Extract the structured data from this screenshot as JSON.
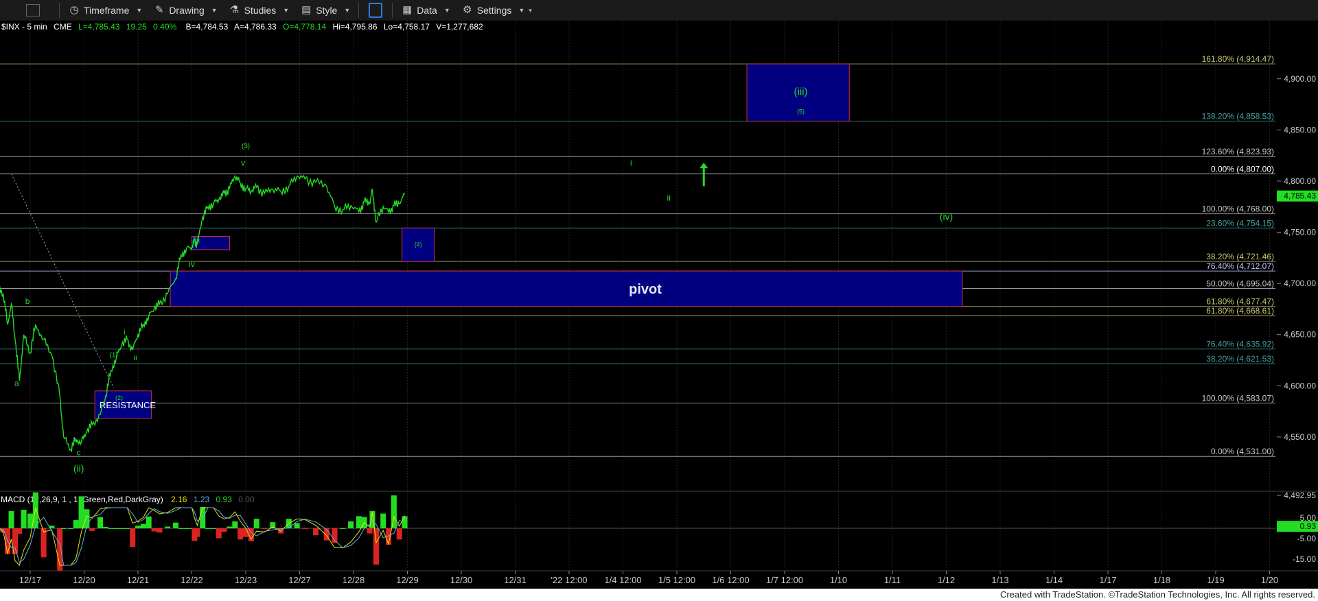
{
  "toolbar": {
    "timeframe": "Timeframe",
    "drawing": "Drawing",
    "studies": "Studies",
    "style": "Style",
    "data": "Data",
    "settings": "Settings",
    "icons": [
      "timeframe-icon",
      "drawing-icon",
      "studies-icon",
      "style-icon",
      "layout-icon",
      "data-icon",
      "settings-icon"
    ]
  },
  "header": {
    "symbol": "$INX - 5 min",
    "exchange": "CME",
    "last": "L=4,785.43",
    "change": "19.25",
    "pct": "0.40%",
    "bid": "B=4,784.53",
    "ask": "A=4,786.33",
    "open": "O=4,778.14",
    "high": "Hi=4,795.86",
    "low": "Lo=4,758.17",
    "volume": "V=1,277,682"
  },
  "footer": "Created with TradeStation. ©TradeStation Technologies, Inc. All rights reserved.",
  "chart_data": {
    "type": "line",
    "title": "$INX - 5 min",
    "color": "#22dd22",
    "ylim": [
      4492.95,
      4930
    ],
    "y_ticks": [
      {
        "v": 4900,
        "t": "4,900.00"
      },
      {
        "v": 4850,
        "t": "4,850.00"
      },
      {
        "v": 4800,
        "t": "4,800.00"
      },
      {
        "v": 4750,
        "t": "4,750.00"
      },
      {
        "v": 4700,
        "t": "4,700.00"
      },
      {
        "v": 4650,
        "t": "4,650.00"
      },
      {
        "v": 4600,
        "t": "4,600.00"
      },
      {
        "v": 4550,
        "t": "4,550.00"
      },
      {
        "v": 4492.95,
        "t": "4,492.95"
      }
    ],
    "last_price": {
      "v": 4785.43,
      "t": "4,785.43"
    },
    "x_labels": [
      {
        "i": 0,
        "t": "12/17"
      },
      {
        "i": 1,
        "t": "12/20"
      },
      {
        "i": 2,
        "t": "12/21"
      },
      {
        "i": 3,
        "t": "12/22"
      },
      {
        "i": 4,
        "t": "12/23"
      },
      {
        "i": 5,
        "t": "12/27"
      },
      {
        "i": 6,
        "t": "12/28"
      },
      {
        "i": 7,
        "t": "12/29"
      },
      {
        "i": 8,
        "t": "12/30"
      },
      {
        "i": 9,
        "t": "12/31"
      },
      {
        "i": 10,
        "t": "'22 12:00"
      },
      {
        "i": 11,
        "t": "1/4 12:00"
      },
      {
        "i": 12,
        "t": "1/5 12:00"
      },
      {
        "i": 13,
        "t": "1/6 12:00"
      },
      {
        "i": 14,
        "t": "1/7 12:00"
      },
      {
        "i": 15,
        "t": "1/10"
      },
      {
        "i": 16,
        "t": "1/11"
      },
      {
        "i": 17,
        "t": "1/12"
      },
      {
        "i": 18,
        "t": "1/13"
      },
      {
        "i": 19,
        "t": "1/14"
      },
      {
        "i": 20,
        "t": "1/17"
      },
      {
        "i": 21,
        "t": "1/18"
      },
      {
        "i": 22,
        "t": "1/19"
      },
      {
        "i": 23,
        "t": "1/20"
      }
    ],
    "price_path": [
      [
        -0.6,
        4695
      ],
      [
        -0.5,
        4690
      ],
      [
        -0.42,
        4660
      ],
      [
        -0.35,
        4680
      ],
      [
        -0.28,
        4645
      ],
      [
        -0.2,
        4605
      ],
      [
        -0.12,
        4650
      ],
      [
        0.0,
        4632
      ],
      [
        0.1,
        4660
      ],
      [
        0.25,
        4645
      ],
      [
        0.4,
        4630
      ],
      [
        0.55,
        4590
      ],
      [
        0.62,
        4550
      ],
      [
        0.75,
        4538
      ],
      [
        0.85,
        4548
      ],
      [
        0.95,
        4545
      ],
      [
        1.05,
        4555
      ],
      [
        1.15,
        4562
      ],
      [
        1.3,
        4572
      ],
      [
        1.4,
        4590
      ],
      [
        1.5,
        4615
      ],
      [
        1.6,
        4628
      ],
      [
        1.7,
        4640
      ],
      [
        1.8,
        4645
      ],
      [
        1.9,
        4635
      ],
      [
        2.0,
        4650
      ],
      [
        2.1,
        4660
      ],
      [
        2.2,
        4668
      ],
      [
        2.3,
        4675
      ],
      [
        2.4,
        4680
      ],
      [
        2.55,
        4690
      ],
      [
        2.7,
        4705
      ],
      [
        2.8,
        4728
      ],
      [
        2.9,
        4734
      ],
      [
        3.0,
        4735
      ],
      [
        3.05,
        4742
      ],
      [
        3.1,
        4738
      ],
      [
        3.2,
        4765
      ],
      [
        3.3,
        4775
      ],
      [
        3.4,
        4778
      ],
      [
        3.5,
        4782
      ],
      [
        3.6,
        4788
      ],
      [
        3.7,
        4793
      ],
      [
        3.8,
        4805
      ],
      [
        3.9,
        4798
      ],
      [
        4.0,
        4793
      ],
      [
        4.1,
        4790
      ],
      [
        4.2,
        4794
      ],
      [
        4.35,
        4788
      ],
      [
        4.5,
        4792
      ],
      [
        4.65,
        4790
      ],
      [
        4.8,
        4795
      ],
      [
        4.95,
        4805
      ],
      [
        5.1,
        4802
      ],
      [
        5.3,
        4799
      ],
      [
        5.5,
        4795
      ],
      [
        5.65,
        4775
      ],
      [
        5.8,
        4772
      ],
      [
        5.95,
        4776
      ],
      [
        6.1,
        4770
      ],
      [
        6.2,
        4780
      ],
      [
        6.3,
        4778
      ],
      [
        6.35,
        4792
      ],
      [
        6.42,
        4760
      ],
      [
        6.55,
        4775
      ],
      [
        6.65,
        4770
      ],
      [
        6.75,
        4776
      ],
      [
        6.85,
        4778
      ],
      [
        6.95,
        4787
      ]
    ],
    "fib_levels": [
      {
        "v": 4914.47,
        "t": "161.80% (4,914.47)",
        "color": "#c8c878"
      },
      {
        "v": 4858.53,
        "t": "138.20% (4,858.53)",
        "color": "#46a0a0"
      },
      {
        "v": 4823.93,
        "t": "123.60% (4,823.93)",
        "color": "#c8c8c8"
      },
      {
        "v": 4807.0,
        "t": "0.00% (4,807.00)",
        "color": "#ffffff"
      },
      {
        "v": 4768.0,
        "t": "100.00% (4,768.00)",
        "color": "#c8c8c8"
      },
      {
        "v": 4754.15,
        "t": "23.60% (4,754.15)",
        "color": "#46a0a0"
      },
      {
        "v": 4721.46,
        "t": "38.20% (4,721.46)",
        "color": "#c8c878"
      },
      {
        "v": 4712.07,
        "t": "76.40% (4,712.07)",
        "color": "#c8c8ff"
      },
      {
        "v": 4695.04,
        "t": "50.00% (4,695.04)",
        "color": "#c8c8c8"
      },
      {
        "v": 4677.47,
        "t": "61.80% (4,677.47)",
        "color": "#c8c878"
      },
      {
        "v": 4668.61,
        "t": "61.80% (4,668.61)",
        "color": "#c8c878"
      },
      {
        "v": 4635.92,
        "t": "76.40% (4,635.92)",
        "color": "#46a0a0"
      },
      {
        "v": 4621.53,
        "t": "38.20% (4,621.53)",
        "color": "#46a0a0"
      },
      {
        "v": 4583.07,
        "t": "100.00% (4,583.07)",
        "color": "#c8c8c8"
      },
      {
        "v": 4531.0,
        "t": "0.00% (4,531.00)",
        "color": "#c8c8c8"
      }
    ],
    "boxes": [
      {
        "name": "iii-target-box",
        "x0": 13.3,
        "x1": 15.2,
        "v0": 4914.47,
        "v1": 4858.53
      },
      {
        "name": "wave-4-support-box",
        "x0": 6.9,
        "x1": 7.5,
        "v0": 4754.15,
        "v1": 4721.46
      },
      {
        "name": "pivot-box",
        "x0": 2.6,
        "x1": 17.3,
        "v0": 4712.07,
        "v1": 4677.47,
        "label": "pivot"
      },
      {
        "name": "resistance-box",
        "x0": 1.2,
        "x1": 2.25,
        "v0": 4595,
        "v1": 4568,
        "label": "RESISTANCE"
      },
      {
        "name": "small-iii-box",
        "x0": 3.0,
        "x1": 3.7,
        "v0": 4746,
        "v1": 4733
      }
    ],
    "wave_labels": [
      {
        "t": "(iii)",
        "x": 14.3,
        "v": 4884,
        "size": 15
      },
      {
        "t": "(5)",
        "x": 14.3,
        "v": 4866,
        "size": 9
      },
      {
        "t": "(iv)",
        "x": 17.0,
        "v": 4762,
        "size": 14
      },
      {
        "t": "(4)",
        "x": 7.2,
        "v": 4736,
        "size": 9
      },
      {
        "t": "(3)",
        "x": 4.0,
        "v": 4832,
        "size": 10
      },
      {
        "t": "v",
        "x": 3.95,
        "v": 4815,
        "size": 12
      },
      {
        "t": "i",
        "x": 11.15,
        "v": 4815,
        "size": 12
      },
      {
        "t": "ii",
        "x": 11.85,
        "v": 4781,
        "size": 12
      },
      {
        "t": "iii",
        "x": 3.1,
        "v": 4740,
        "size": 11
      },
      {
        "t": "iv",
        "x": 3.0,
        "v": 4716,
        "size": 12
      },
      {
        "t": "(1)",
        "x": 1.55,
        "v": 4628,
        "size": 10
      },
      {
        "t": "(2)",
        "x": 1.65,
        "v": 4586,
        "size": 9
      },
      {
        "t": "i",
        "x": 1.75,
        "v": 4650,
        "size": 11
      },
      {
        "t": "ii",
        "x": 1.95,
        "v": 4625,
        "size": 11
      },
      {
        "t": "b",
        "x": -0.05,
        "v": 4680,
        "size": 12
      },
      {
        "t": "a",
        "x": -0.25,
        "v": 4600,
        "size": 12
      },
      {
        "t": "c",
        "x": 0.9,
        "v": 4532,
        "size": 12
      },
      {
        "t": "(ii)",
        "x": 0.9,
        "v": 4516,
        "size": 14
      }
    ],
    "arrow": {
      "x": 12.5,
      "v0": 4795,
      "v1": 4818
    },
    "macd": {
      "label": "MACD (12,26,9, 1 , 1 ,Green,Red,DarkGray)",
      "values": [
        "2.16",
        "1.23",
        "0.93",
        "0.00"
      ],
      "value_colors": [
        "#e6e600",
        "#5ab4e6",
        "#22dd22",
        "#555555"
      ],
      "ylim": [
        -20,
        12
      ],
      "y_ticks": [
        {
          "v": 5,
          "t": "5.00"
        },
        {
          "v": -5,
          "t": "-5.00"
        },
        {
          "v": -15,
          "t": "-15.00"
        }
      ],
      "last": {
        "v": 0.93,
        "t": "0.93"
      }
    }
  }
}
